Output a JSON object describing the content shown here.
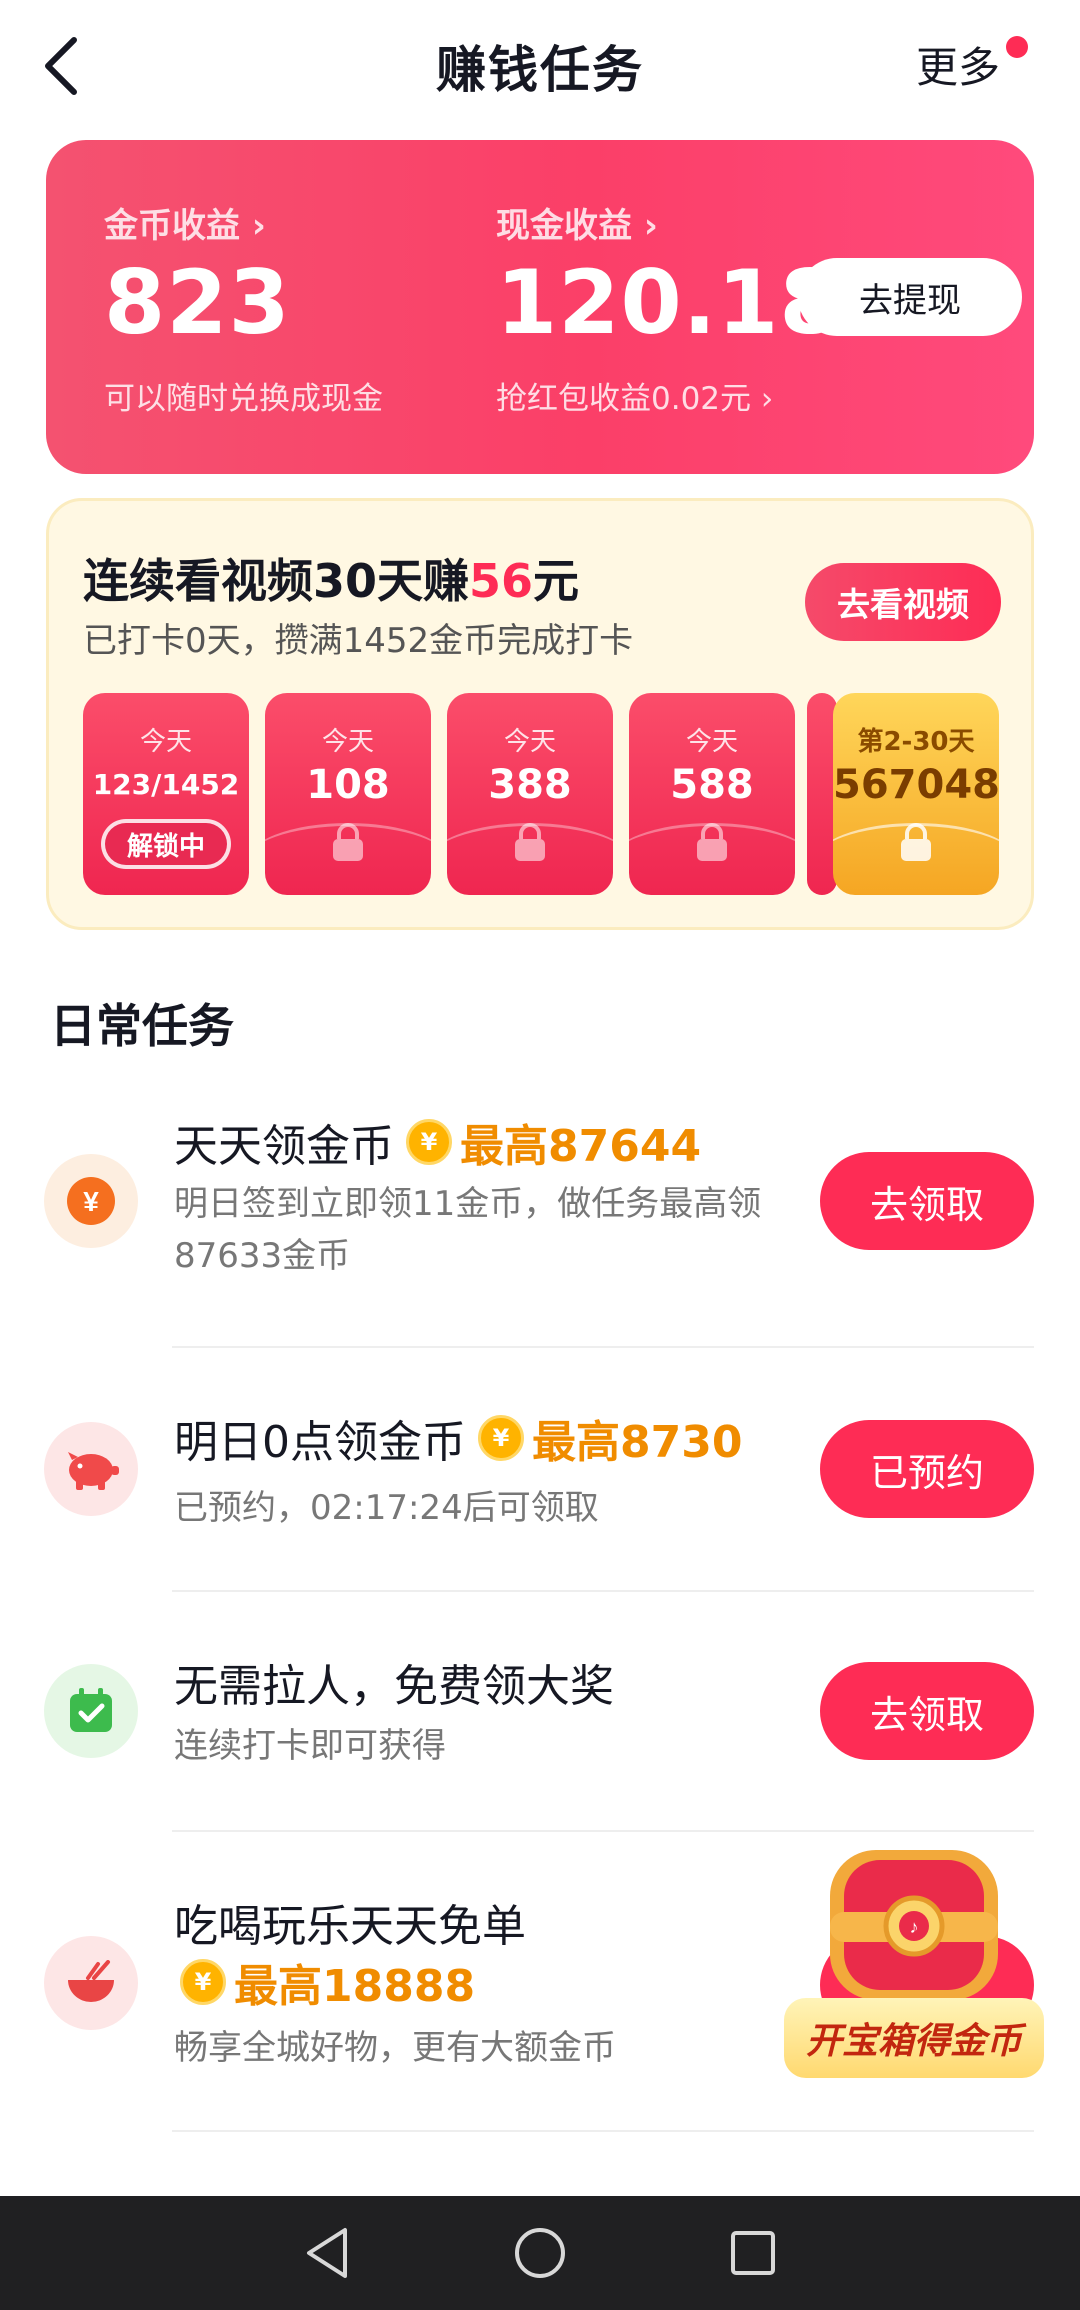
{
  "header": {
    "title": "赚钱任务",
    "more_label": "更多"
  },
  "earnings": {
    "coin_label": "金币收益",
    "coin_value": "823",
    "coin_sub": "可以随时兑换成现金",
    "cash_label": "现金收益",
    "cash_value": "120.18",
    "cash_sub": "抢红包收益0.02元",
    "withdraw_button": "去提现"
  },
  "checkin": {
    "title_prefix": "连续看视频30天赚",
    "title_amount": "56",
    "title_suffix": "元",
    "subtitle": "已打卡0天，攒满1452金币完成打卡",
    "button": "去看视频",
    "tiles": [
      {
        "label": "今天",
        "value": "123/1452",
        "action": "解锁中"
      },
      {
        "label": "今天",
        "value": "108"
      },
      {
        "label": "今天",
        "value": "388"
      },
      {
        "label": "今天",
        "value": "588"
      },
      {
        "label": "",
        "value": ""
      },
      {
        "label": "第2-30天",
        "value": "567048"
      }
    ]
  },
  "daily": {
    "section_title": "日常任务",
    "tasks": [
      {
        "title": "天天领金币",
        "coin_glyph": "¥",
        "max": "最高87644",
        "desc": "明日签到立即领11金币，做任务最高领87633金币",
        "button": "去领取"
      },
      {
        "title": "明日0点领金币",
        "coin_glyph": "¥",
        "max": "最高8730",
        "desc": "已预约，02:17:24后可领取",
        "button": "已预约"
      },
      {
        "title": "无需拉人，免费领大奖",
        "desc": "连续打卡即可获得",
        "button": "去领取"
      },
      {
        "title": "吃喝玩乐天天免单",
        "coin_glyph": "¥",
        "max": "最高18888",
        "desc": "畅享全城好物，更有大额金币"
      }
    ]
  },
  "treasure": {
    "label": "开宝箱得金币"
  },
  "icons": {
    "back": "back-arrow-icon",
    "coin_task": "yuan-coin-icon",
    "pig": "piggy-bank-icon",
    "calendar": "calendar-check-icon",
    "bowl": "food-bowl-icon",
    "nav_back": "nav-back-icon",
    "nav_home": "nav-home-icon",
    "nav_recents": "nav-recents-icon"
  },
  "colors": {
    "accent": "#fe2c55",
    "gold": "#f08c00",
    "checkin_bg": "#fff8e3"
  }
}
